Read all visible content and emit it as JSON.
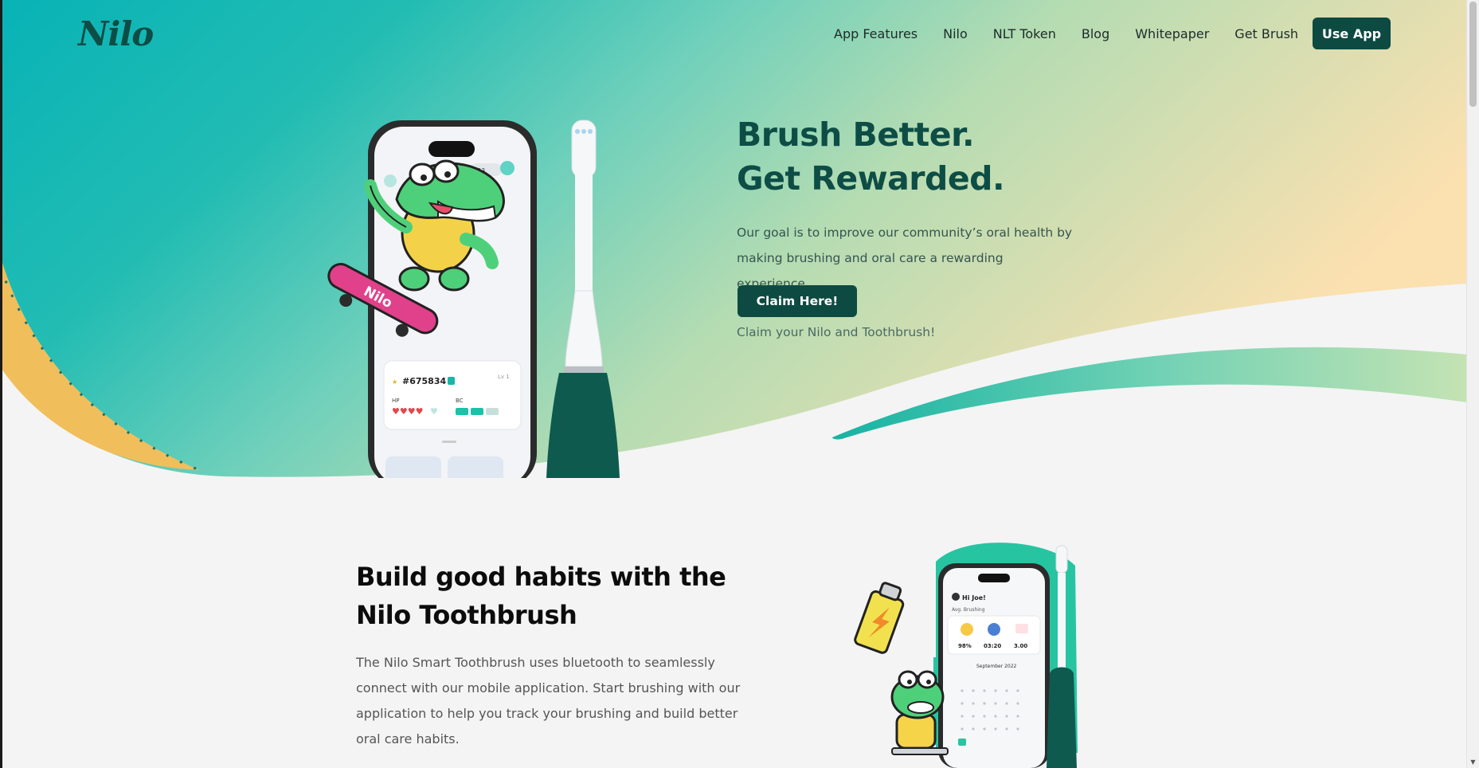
{
  "brand": {
    "logo_text": "Nilo"
  },
  "nav": {
    "items": [
      {
        "label": "App Features"
      },
      {
        "label": "Nilo"
      },
      {
        "label": "NLT Token"
      },
      {
        "label": "Blog"
      },
      {
        "label": "Whitepaper"
      },
      {
        "label": "Get Brush"
      }
    ],
    "cta_label": "Use App"
  },
  "hero": {
    "title_line1": "Brush Better.",
    "title_line2": "Get Rewarded.",
    "description": "Our goal is to improve our community’s oral health by making brushing and oral care a rewarding experience.",
    "button_label": "Claim Here!",
    "note": "Claim your Nilo and Toothbrush!",
    "phone": {
      "coin_count": "33",
      "player_id": "#675834",
      "level": "Lv 1",
      "hp_label": "HP",
      "bc_label": "BC"
    }
  },
  "section2": {
    "title": "Build good habits with the Nilo Toothbrush",
    "description": "The Nilo Smart Toothbrush uses bluetooth to seamlessly connect with our mobile application. Start brushing with our application to help you track your brushing and build better oral care habits.",
    "phone": {
      "greeting": "Hi Joe!",
      "subtitle": "Avg. Brushing",
      "stat1": "98%",
      "stat2": "03:20",
      "stat3": "3.00",
      "month": "September 2022"
    }
  },
  "colors": {
    "brand_dark": "#0d4a42",
    "teal": "#1ab9b4",
    "peach": "#f9e1b1",
    "background": "#f4f4f4"
  }
}
